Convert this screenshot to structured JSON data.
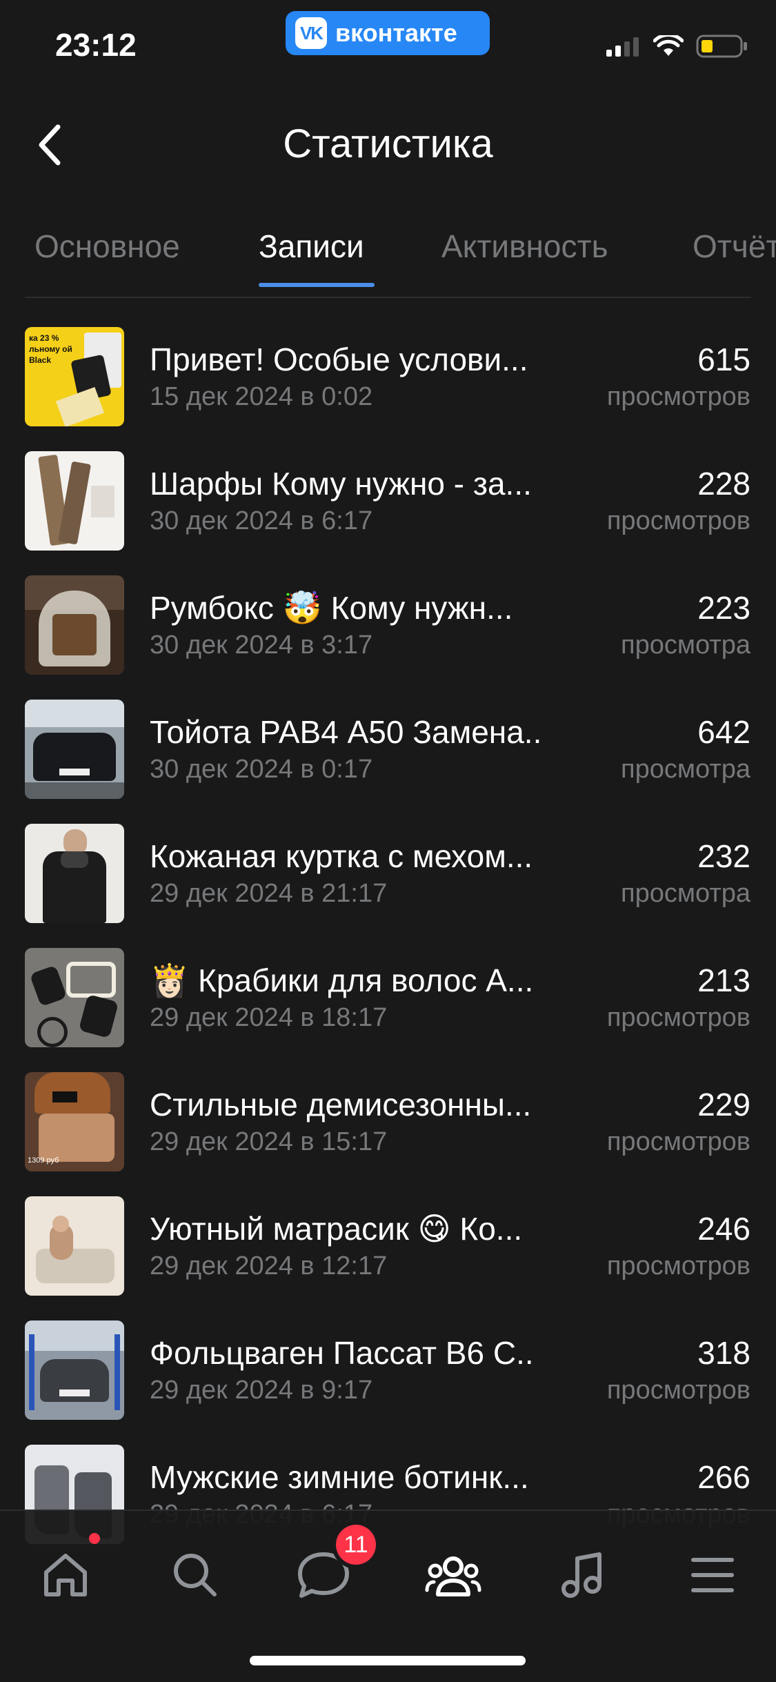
{
  "status_bar": {
    "time": "23:12",
    "app_badge": "вконтакте",
    "app_logo": "VK"
  },
  "header": {
    "title": "Статистика"
  },
  "tabs": [
    {
      "label": "Основное",
      "active": false
    },
    {
      "label": "Записи",
      "active": true
    },
    {
      "label": "Активность",
      "active": false
    },
    {
      "label": "Отчёты",
      "active": false
    }
  ],
  "posts": [
    {
      "title": "Привет! Особые услови...",
      "date": "15 дек 2024 в 0:02",
      "views": "615",
      "views_label": "просмотров",
      "thumb_caption": "ка 23 % льному ой Black",
      "thumb_icon": "promo-card-image"
    },
    {
      "title": "Шарфы Кому нужно - за...",
      "date": "30 дек 2024 в 6:17",
      "views": "228",
      "views_label": "просмотров",
      "thumb_icon": "scarf-image"
    },
    {
      "title": "Румбокс 🤯 Кому нужн...",
      "date": "30 дек 2024 в 3:17",
      "views": "223",
      "views_label": "просмотра",
      "thumb_icon": "roombox-image"
    },
    {
      "title": "Тойота РАВ4 А50 Замена..",
      "date": "30 дек 2024 в 0:17",
      "views": "642",
      "views_label": "просмотра",
      "thumb_icon": "car-image"
    },
    {
      "title": "Кожаная куртка с мехом...",
      "date": "29 дек 2024 в 21:17",
      "views": "232",
      "views_label": "просмотра",
      "thumb_icon": "jacket-image"
    },
    {
      "title": "👸🏻 Крабики для волос А...",
      "date": "29 дек 2024 в 18:17",
      "views": "213",
      "views_label": "просмотров",
      "thumb_icon": "hair-clips-image"
    },
    {
      "title": "Стильные демисезонны...",
      "date": "29 дек 2024 в 15:17",
      "views": "229",
      "views_label": "просмотров",
      "thumb_caption": "1309 руб",
      "thumb_icon": "hat-image"
    },
    {
      "title": "Уютный матрасик 😋 Ко...",
      "date": "29 дек 2024 в 12:17",
      "views": "246",
      "views_label": "просмотров",
      "thumb_icon": "mattress-image"
    },
    {
      "title": "Фольцваген Пассат В6 С..",
      "date": "29 дек 2024 в 9:17",
      "views": "318",
      "views_label": "просмотров",
      "thumb_icon": "car-garage-image"
    },
    {
      "title": "Мужские зимние ботинк...",
      "date": "29 дек 2024 в 6:17",
      "views": "266",
      "views_label": "просмотров",
      "thumb_icon": "boots-image"
    }
  ],
  "tab_bar": {
    "items": [
      "home-icon",
      "search-icon",
      "messages-icon",
      "communities-icon",
      "music-icon",
      "menu-icon"
    ],
    "messages_badge": "11"
  },
  "colors": {
    "background": "#19191a",
    "accent": "#4c8ee8",
    "vk_blue": "#2787f5",
    "badge_red": "#ff3347",
    "secondary_text": "#76787a"
  }
}
